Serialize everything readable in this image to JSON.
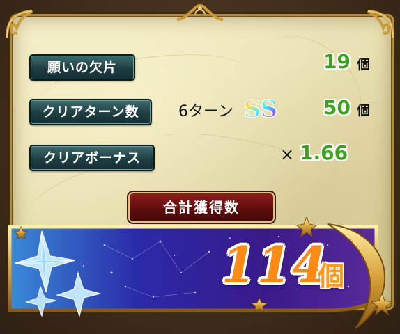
{
  "rows": [
    {
      "label": "願いの欠片",
      "value": "19",
      "unit": "個"
    },
    {
      "label": "クリアターン数",
      "turns": "6ターン",
      "rank": "SS",
      "value": "50",
      "unit": "個"
    },
    {
      "label": "クリアボーナス",
      "multiplier_sign": "×",
      "value": "1.66"
    }
  ],
  "total": {
    "label": "合計獲得数",
    "value": "114",
    "unit": "個"
  },
  "colors": {
    "value_green": "#3da020",
    "total_orange": "#ff8a14",
    "label_teal": "#1f3e42",
    "total_label_red": "#7a1414"
  },
  "icons": [
    "crystal-star-icon",
    "crescent-moon-icon",
    "gold-star-icon",
    "ss-rank-badge-icon"
  ]
}
